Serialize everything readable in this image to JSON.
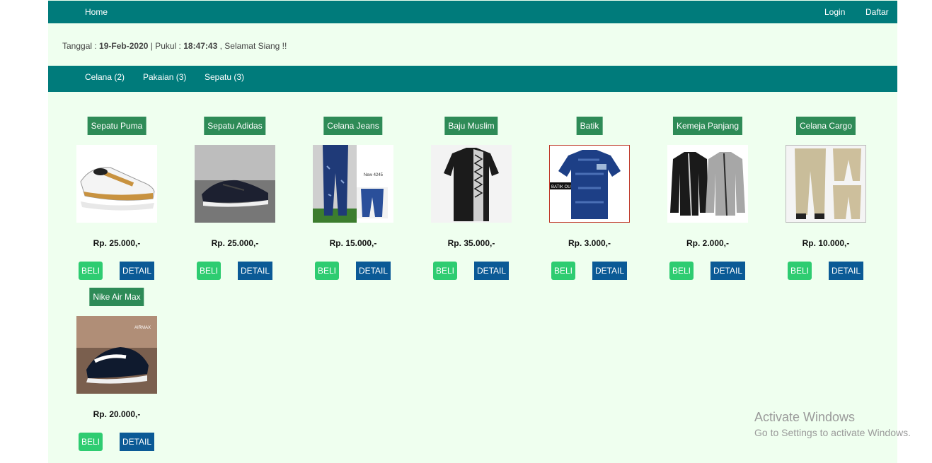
{
  "topnav": {
    "home": "Home",
    "login": "Login",
    "register": "Daftar"
  },
  "datebar": {
    "date_label": "Tanggal : ",
    "date": "19-Feb-2020",
    "time_label": " | Pukul : ",
    "time": "18:47:43",
    "greeting": " , Selamat Siang !!"
  },
  "categories": [
    {
      "label": "Celana (2)"
    },
    {
      "label": "Pakaian (3)"
    },
    {
      "label": "Sepatu (3)"
    }
  ],
  "products": [
    {
      "name": "Sepatu Puma",
      "price_prefix": "Rp. ",
      "price": "25.000,-",
      "buy": "BELI",
      "detail": "DETAIL",
      "image": "shoe-white-gold"
    },
    {
      "name": "Sepatu Adidas",
      "price_prefix": "Rp. ",
      "price": "25.000,-",
      "buy": "BELI",
      "detail": "DETAIL",
      "image": "shoe-black"
    },
    {
      "name": "Celana Jeans",
      "price_prefix": "Rp. ",
      "price": "15.000,-",
      "buy": "BELI",
      "detail": "DETAIL",
      "image": "jeans"
    },
    {
      "name": "Baju Muslim",
      "price_prefix": "Rp. ",
      "price": "35.000,-",
      "buy": "BELI",
      "detail": "DETAIL",
      "image": "muslim-shirt"
    },
    {
      "name": "Batik",
      "price_prefix": "Rp. ",
      "price": "3.000,-",
      "buy": "BELI",
      "detail": "DETAIL",
      "image": "batik-shirt"
    },
    {
      "name": "Kemeja Panjang",
      "price_prefix": "Rp. ",
      "price": "2.000,-",
      "buy": "BELI",
      "detail": "DETAIL",
      "image": "long-shirts"
    },
    {
      "name": "Celana Cargo",
      "price_prefix": "Rp. ",
      "price": "10.000,-",
      "buy": "BELI",
      "detail": "DETAIL",
      "image": "cargo-pants"
    },
    {
      "name": "Nike Air Max",
      "price_prefix": "Rp. ",
      "price": "20.000,-",
      "buy": "BELI",
      "detail": "DETAIL",
      "image": "shoe-nike"
    }
  ],
  "image_labels": {
    "jeans_tag": "New 4245",
    "batik_tag": "BATIK OU",
    "nike_tag": "AIRMAX"
  },
  "watermark": {
    "line1": "Activate Windows",
    "line2": "Go to Settings to activate Windows."
  },
  "colors": {
    "nav": "#007b7b",
    "page_bg": "#efffef",
    "title_bg": "#2e8b57",
    "buy": "#2ecc71",
    "detail": "#0b5a96"
  }
}
